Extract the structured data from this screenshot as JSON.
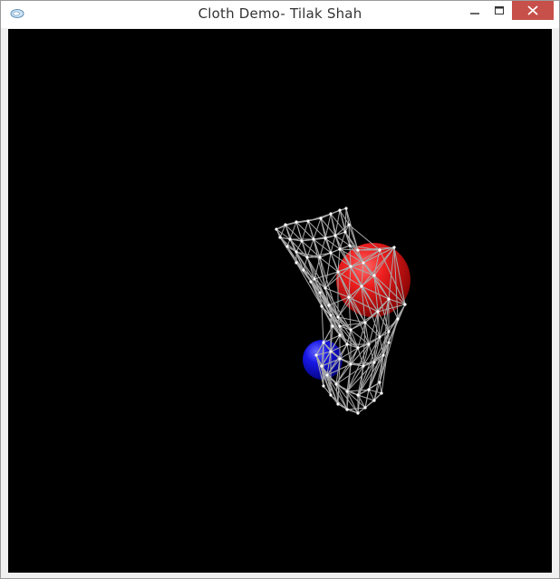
{
  "window": {
    "title": "Cloth Demo- Tilak Shah"
  },
  "colors": {
    "background": "#000000",
    "cloth_edges": "#a9a9a9",
    "cloth_nodes": "#ffffff",
    "red_sphere": "#e01010",
    "blue_sphere": "#1010d8",
    "close_button": "#c7504a"
  },
  "icons": {
    "app": "app-icon",
    "minimize": "minimize-icon",
    "maximize": "maximize-icon",
    "close": "close-icon"
  }
}
